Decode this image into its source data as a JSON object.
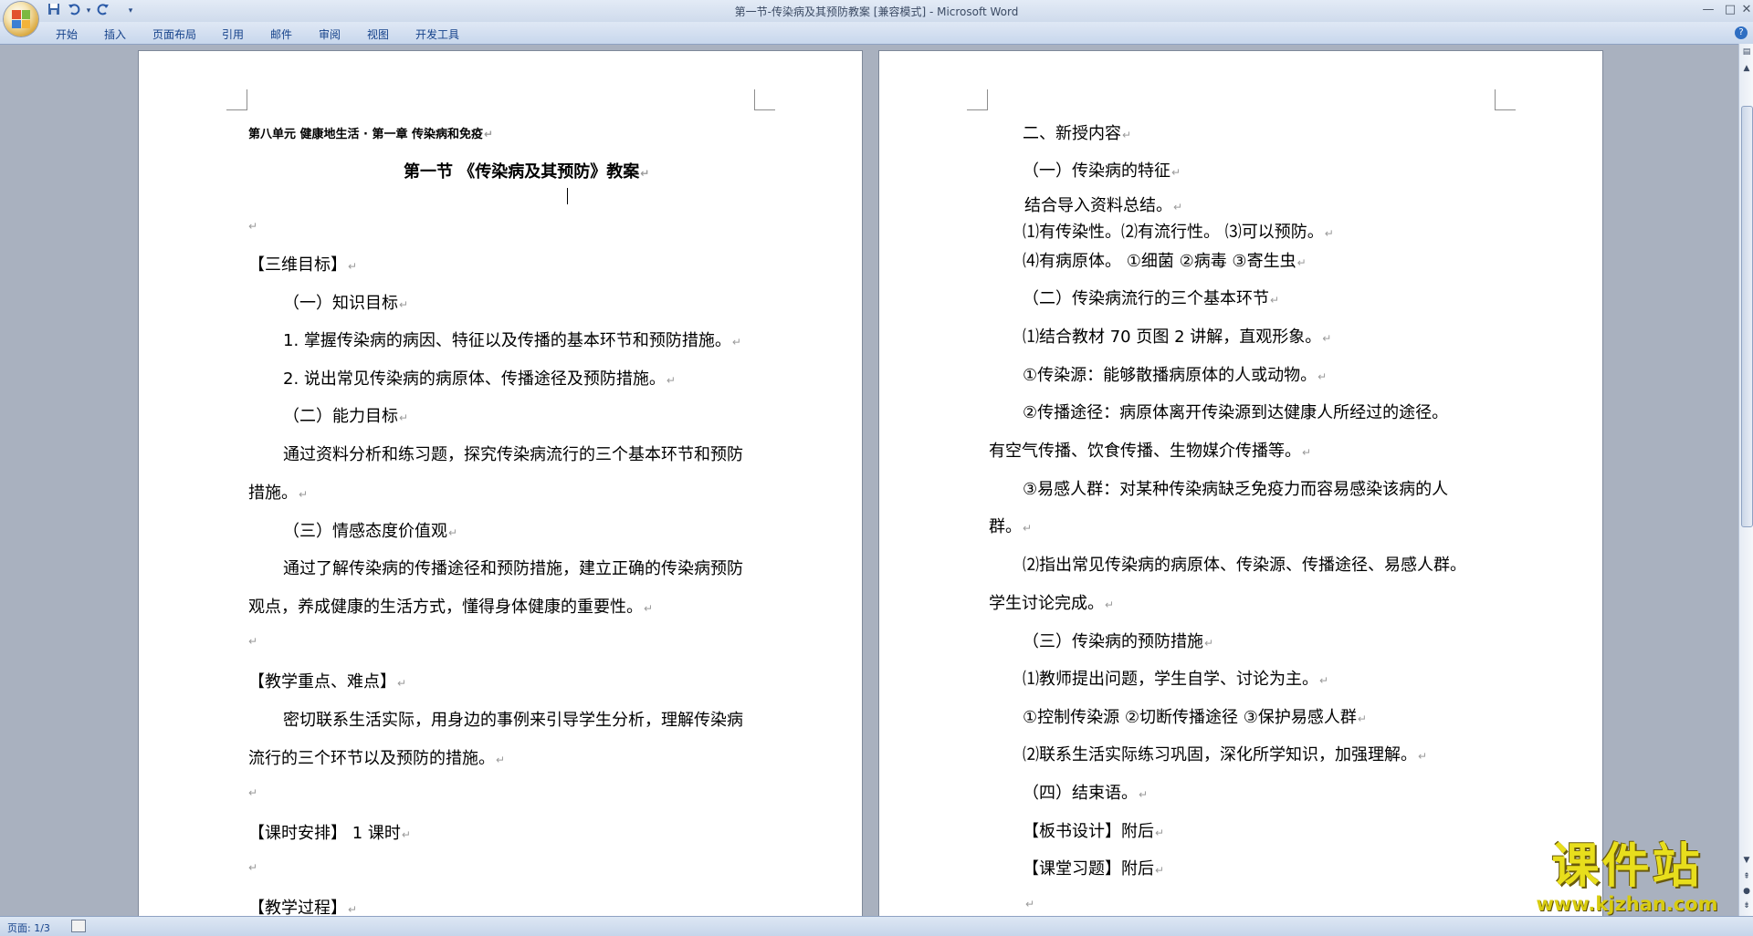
{
  "window": {
    "title": "第一节-传染病及其预防教案 [兼容模式] - Microsoft Word",
    "minimize": "—",
    "maximize": "□",
    "close": "✕"
  },
  "quick_access": {
    "save_icon": "save-icon",
    "undo_icon": "undo-icon",
    "redo_icon": "redo-icon",
    "customize": "▾"
  },
  "ribbon": {
    "tabs": [
      "开始",
      "插入",
      "页面布局",
      "引用",
      "邮件",
      "审阅",
      "视图",
      "开发工具"
    ],
    "help": "?"
  },
  "document": {
    "left_page": {
      "header_line": "第八单元   健康地生活  ·  第一章     传染病和免疫",
      "title": "第一节      《传染病及其预防》教案",
      "paragraphs": [
        "【三维目标】",
        "（一）知识目标",
        "1. 掌握传染病的病因、特征以及传播的基本环节和预防措施。",
        "2. 说出常见传染病的病原体、传播途径及预防措施。",
        "（二）能力目标",
        "通过资料分析和练习题，探究传染病流行的三个基本环节和预防",
        "措施。",
        "（三）情感态度价值观",
        "通过了解传染病的传播途径和预防措施，建立正确的传染病预防",
        "观点，养成健康的生活方式，懂得身体健康的重要性。",
        "【教学重点、难点】",
        "密切联系生活实际，用身边的事例来引导学生分析，理解传染病",
        "流行的三个环节以及预防的措施。",
        "【课时安排】   1 课时",
        "【教学过程】"
      ]
    },
    "right_page": {
      "paragraphs": [
        "二、新授内容",
        "（一）传染病的特征",
        "结合导入资料总结。",
        "⑴有传染性。⑵有流行性。 ⑶可以预防。",
        "⑷有病原体。 ①细菌   ②病毒    ③寄生虫",
        "（二）传染病流行的三个基本环节",
        "⑴结合教材 70 页图 2 讲解，直观形象。",
        "①传染源：能够散播病原体的人或动物。",
        "②传播途径：病原体离开传染源到达健康人所经过的途径。",
        "有空气传播、饮食传播、生物媒介传播等。",
        "③易感人群：对某种传染病缺乏免疫力而容易感染该病的人",
        "群。",
        "⑵指出常见传染病的病原体、传染源、传播途径、易感人群。",
        "学生讨论完成。",
        "（三）传染病的预防措施",
        "⑴教师提出问题，学生自学、讨论为主。",
        "①控制传染源    ②切断传播途径    ③保护易感人群",
        "⑵联系生活实际练习巩固，深化所学知识，加强理解。",
        "（四）结束语。",
        "【板书设计】附后",
        "【课堂习题】附后"
      ]
    }
  },
  "status_bar": {
    "page_info": "页面: 1/3"
  },
  "watermark": {
    "title": "课件站",
    "url": "www.kjzhan.com"
  },
  "colors": {
    "workspace": "#a9b1bf",
    "ribbon_text": "#15428b",
    "watermark_yellow": "#e8de1c"
  }
}
